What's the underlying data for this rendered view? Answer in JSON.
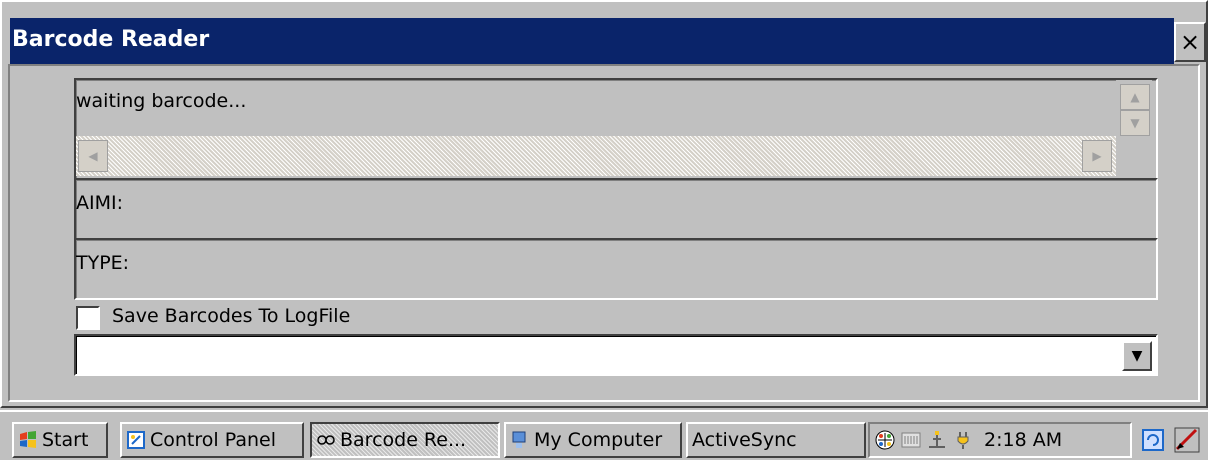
{
  "window": {
    "title": "Barcode Reader",
    "close_symbol": "×"
  },
  "result": {
    "text": "waiting barcode..."
  },
  "aimi": {
    "label": "AIMI:"
  },
  "type": {
    "label": "TYPE:"
  },
  "save_log": {
    "label": "Save Barcodes To LogFile",
    "checked": false
  },
  "log_file_combo": {
    "value": ""
  },
  "taskbar": {
    "start": "Start",
    "items": [
      {
        "label": "Control Panel",
        "icon": "control-panel-icon"
      },
      {
        "label": "Barcode Re...",
        "icon": "barcode-icon"
      },
      {
        "label": "My Computer",
        "icon": "computer-icon"
      },
      {
        "label": "ActiveSync",
        "icon": ""
      }
    ],
    "clock": "2:18 AM"
  },
  "colors": {
    "titlebar": "#0a246a",
    "face": "#c0c0c0"
  }
}
